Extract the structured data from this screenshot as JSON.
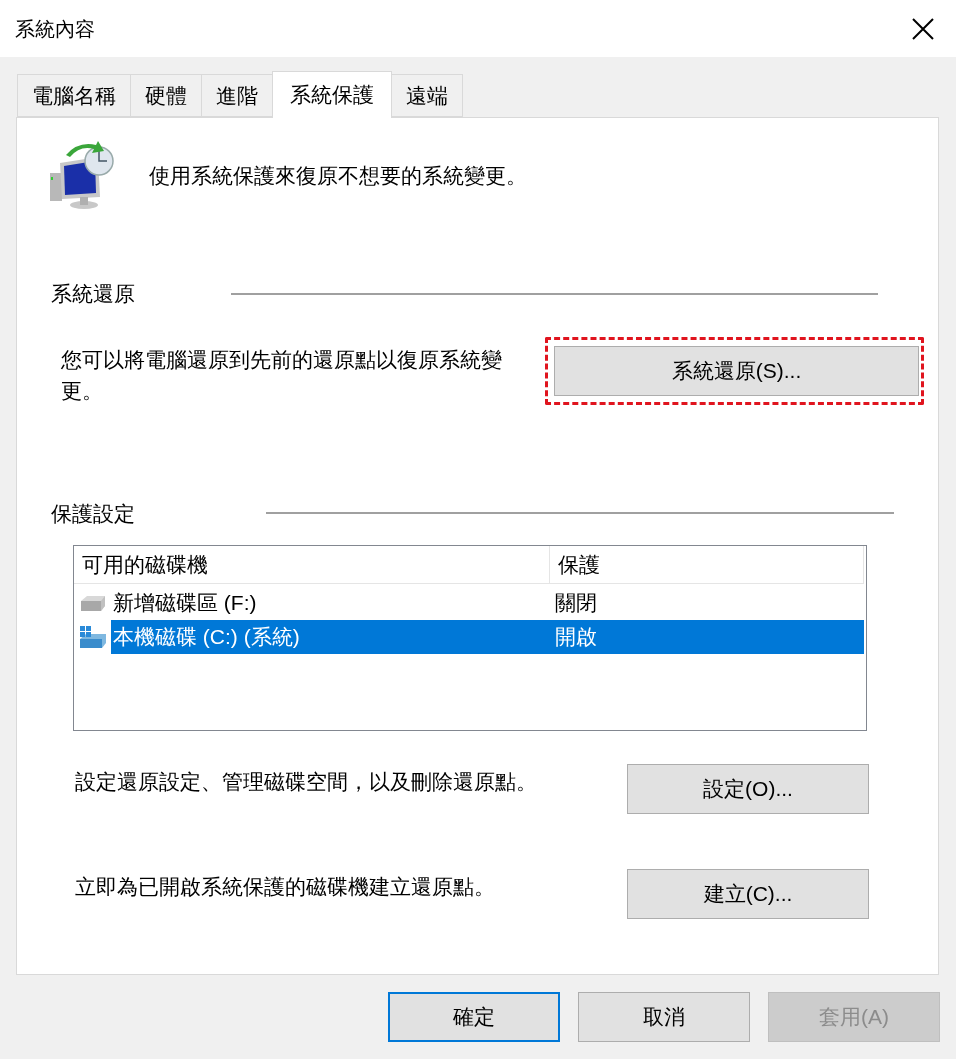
{
  "window": {
    "title": "系統內容"
  },
  "tabs": [
    {
      "label": "電腦名稱",
      "selected": false
    },
    {
      "label": "硬體",
      "selected": false
    },
    {
      "label": "進階",
      "selected": false
    },
    {
      "label": "系統保護",
      "selected": true
    },
    {
      "label": "遠端",
      "selected": false
    }
  ],
  "intro": "使用系統保護來復原不想要的系統變更。",
  "system_restore": {
    "title": "系統還原",
    "description": "您可以將電腦還原到先前的還原點以復原系統變更。",
    "button": {
      "label": "系統還原(S)...",
      "highlighted": true
    }
  },
  "protection_settings": {
    "title": "保護設定",
    "table": {
      "columns": [
        "可用的磁碟機",
        "保護"
      ],
      "rows": [
        {
          "kind": "drive",
          "drive": "新增磁碟區 (F:)",
          "protection": "關閉",
          "selected": false
        },
        {
          "kind": "system-drive",
          "drive": "本機磁碟 (C:) (系統)",
          "protection": "開啟",
          "selected": true
        }
      ]
    },
    "configure": {
      "description": "設定還原設定、管理磁碟空間，以及刪除還原點。",
      "button": "設定(O)..."
    },
    "create": {
      "description": "立即為已開啟系統保護的磁碟機建立還原點。",
      "button": "建立(C)..."
    }
  },
  "buttons": [
    {
      "label": "確定",
      "kind": "default",
      "disabled": false
    },
    {
      "label": "取消",
      "kind": "normal",
      "disabled": false
    },
    {
      "label": "套用(A)",
      "kind": "normal",
      "disabled": true
    }
  ]
}
